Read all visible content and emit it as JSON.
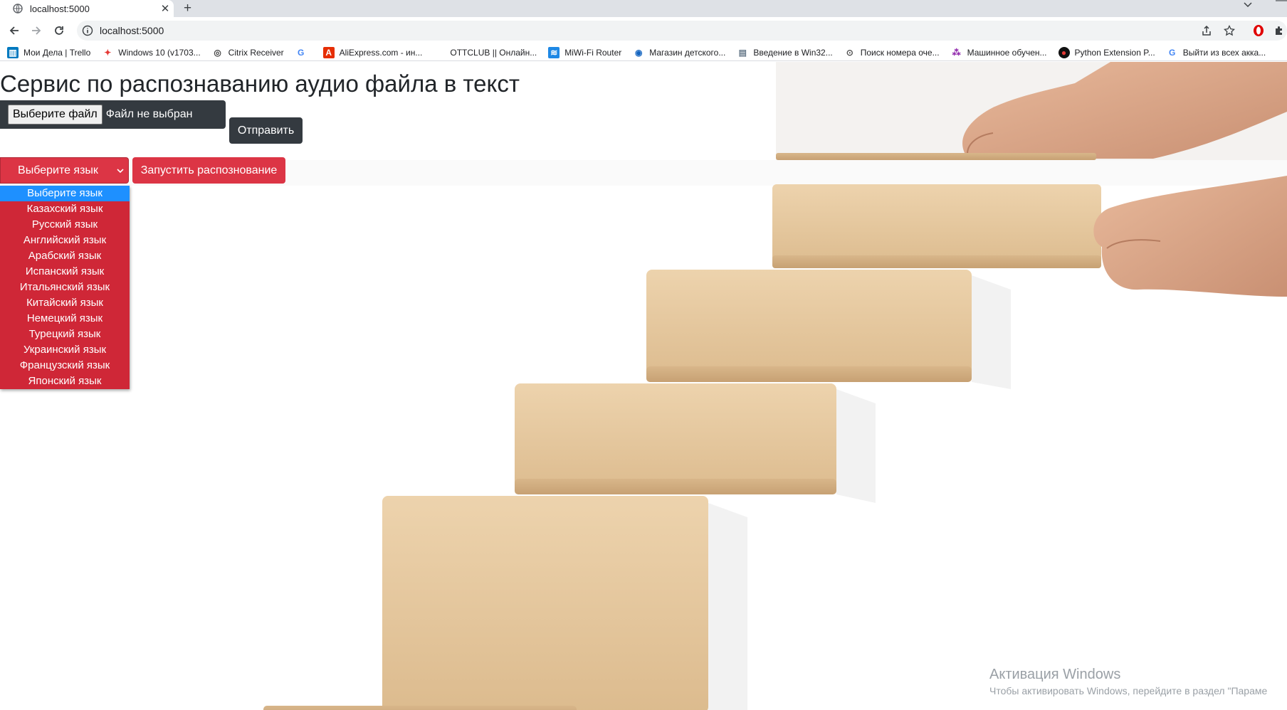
{
  "browser": {
    "tab_title": "localhost:5000",
    "url": "localhost:5000",
    "bookmarks": [
      {
        "label": "Мои Дела | Trello",
        "icon": "trello-icon",
        "color": "#0079bf"
      },
      {
        "label": "Windows 10 (v1703...",
        "icon": "colorful-bird-icon",
        "color": "#e53935"
      },
      {
        "label": "Citrix Receiver",
        "icon": "citrix-icon",
        "color": "#444444"
      },
      {
        "label": "",
        "icon": "google-icon",
        "color": "#4285f4"
      },
      {
        "label": "AliExpress.com - ин...",
        "icon": "aliexpress-icon",
        "color": "#e62e04"
      },
      {
        "label": "OTTCLUB || Онлайн...",
        "icon": "ottclub-icon",
        "color": "#ffffff"
      },
      {
        "label": "MiWi-Fi Router",
        "icon": "wifi-icon",
        "color": "#1e88e5"
      },
      {
        "label": "Магазин детского...",
        "icon": "shop-globe-icon",
        "color": "#1565c0"
      },
      {
        "label": "Введение в Win32...",
        "icon": "document-icon",
        "color": "#6a7b8c"
      },
      {
        "label": "Поиск номера оче...",
        "icon": "search-number-icon",
        "color": "#555555"
      },
      {
        "label": "Машинное обучен...",
        "icon": "molecule-icon",
        "color": "#8e24aa"
      },
      {
        "label": "Python Extension P...",
        "icon": "python-ext-icon",
        "color": "#b71c1c"
      },
      {
        "label": "Выйти из всех акка...",
        "icon": "google-icon",
        "color": "#4285f4"
      }
    ]
  },
  "page": {
    "title": "Сервис по распознаванию аудио файла в текст",
    "file_button": "Выберите файл",
    "file_status": "Файл не выбран",
    "submit_button": "Отправить",
    "language_select": "Выберите язык",
    "start_button": "Запустить распознование",
    "language_options": [
      "Выберите язык",
      "Казахский язык",
      "Русский язык",
      "Английский язык",
      "Арабский язык",
      "Испанский язык",
      "Итальянский язык",
      "Китайский язык",
      "Немецкий язык",
      "Турецкий язык",
      "Украинский язык",
      "Французский язык",
      "Японский язык"
    ],
    "selected_option_index": 0
  },
  "watermark": {
    "title": "Активация Windows",
    "subtitle": "Чтобы активировать Windows, перейдите в раздел \"Параме"
  },
  "colors": {
    "danger": "#dc3545",
    "dark": "#343a40",
    "highlight": "#1e90ff"
  }
}
